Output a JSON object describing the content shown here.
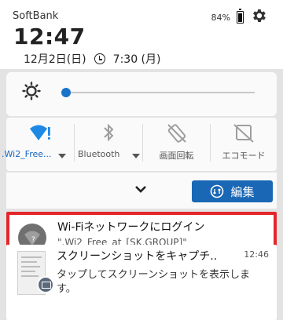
{
  "status_bar": {
    "carrier": "SoftBank",
    "battery_percent": "84%"
  },
  "header": {
    "time": "12:47",
    "date": "12月2日(日)",
    "alarm": "7:30 (月)"
  },
  "brightness": {
    "level": 0.0
  },
  "quick_tiles": [
    {
      "label": ".Wi2_Free...",
      "icon": "wifi-alert-icon",
      "has_dropdown": true
    },
    {
      "label": "Bluetooth",
      "icon": "bluetooth-off-icon",
      "has_dropdown": true
    },
    {
      "label": "画面回転",
      "icon": "rotate-off-icon",
      "has_dropdown": false
    },
    {
      "label": "エコモード",
      "icon": "eco-off-icon",
      "has_dropdown": false
    }
  ],
  "actions": {
    "edit_label": "編集"
  },
  "notifications": [
    {
      "title": "Wi-Fiネットワークにログイン",
      "body": "\".Wi2_Free_at_[SK.GROUP]\"",
      "icon": "wifi-question-icon",
      "highlighted": true
    },
    {
      "title": "スクリーンショットをキャプチ..",
      "time": "12:46",
      "body": "タップしてスクリーンショットを表示しま",
      "body2": "す。",
      "icon": "screenshot-icon"
    }
  ],
  "colors": {
    "accent": "#1967b5",
    "highlight": "#e3262b",
    "wifi_tile": "#1565c0"
  }
}
